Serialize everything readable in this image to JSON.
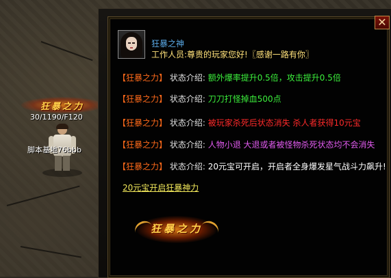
{
  "hero": {
    "title": "狂暴之力",
    "hp": "30/1190/F120",
    "name": "脚本基地76bbb"
  },
  "dialog": {
    "close_label": "✕",
    "npc_name": "狂暴之神",
    "greeting": "工作人员:尊贵的玩家您好!〖感谢一路有你〗",
    "rows": [
      {
        "tag": "【狂暴之力】",
        "label": "状态介绍:",
        "desc": "额外爆率提升0.5倍，攻击提升0.5倍",
        "color": "#3cf03c"
      },
      {
        "tag": "【狂暴之力】",
        "label": "状态介绍:",
        "desc": "刀刀打怪掉血500点",
        "color": "#3cf03c"
      },
      {
        "tag": "【狂暴之力】",
        "label": "状态介绍:",
        "desc": "被玩家杀死后状态消失 杀人者获得10元宝",
        "color": "#ff2a2a"
      },
      {
        "tag": "【狂暴之力】",
        "label": "状态介绍:",
        "desc": "人物小退 大退或者被怪物杀死状态均不会消失",
        "color": "#e25bf0"
      },
      {
        "tag": "【狂暴之力】",
        "label": "状态介绍:",
        "desc": "20元宝可开启，开启者全身爆发星气战斗力飙升!",
        "color": "#ffffff"
      }
    ],
    "open_link": "20元宝开启狂暴神力",
    "emblem_text": "狂暴之力"
  }
}
